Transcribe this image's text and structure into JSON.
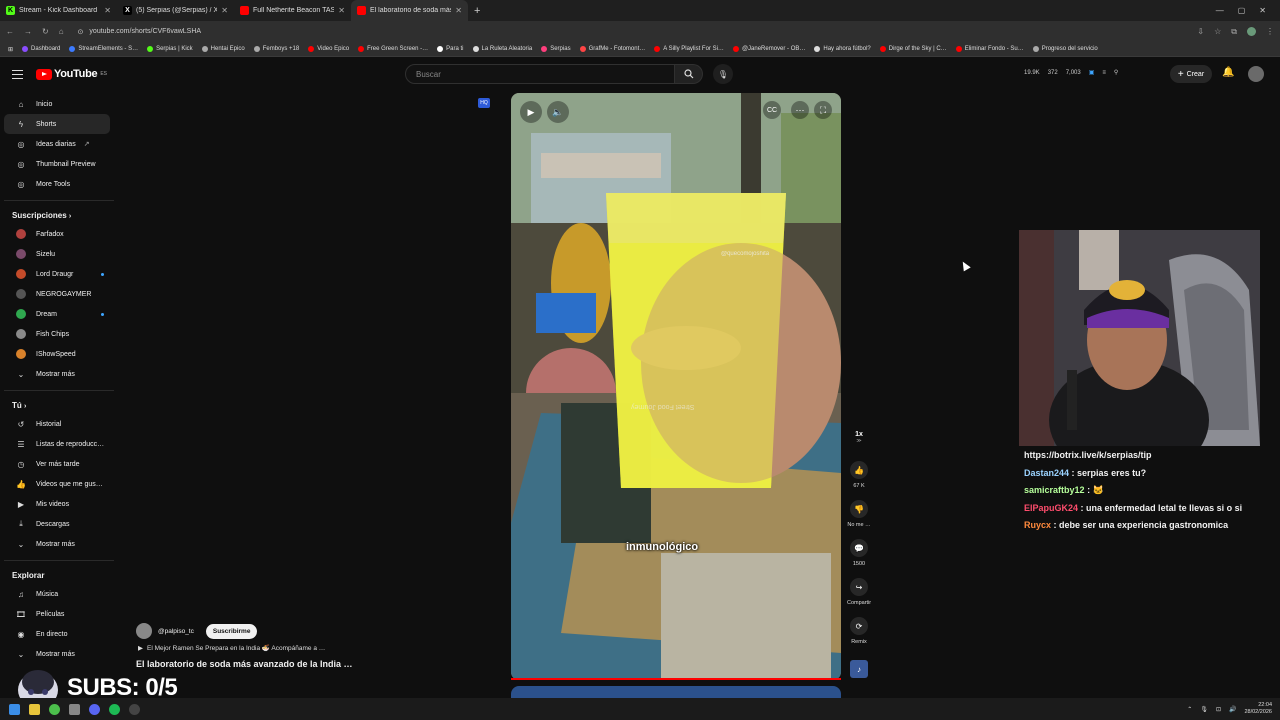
{
  "browser": {
    "tabs": [
      {
        "title": "Stream - Kick Dashboard",
        "icon": "kick-icon",
        "color": "#53fc18"
      },
      {
        "title": "(5) Serpias (@Serpias) / X",
        "icon": "x-icon",
        "color": "#ffffff"
      },
      {
        "title": "Full Netherite Beacon TAS (4 m…",
        "icon": "youtube-icon",
        "color": "#ff0000"
      },
      {
        "title": "El laboratorio de soda más avan…",
        "icon": "youtube-icon",
        "color": "#ff0000",
        "active": true
      }
    ],
    "new_tab": "+",
    "url": "youtube.com/shorts/CVF6vawLSHA",
    "bookmarks": [
      {
        "label": "Dashboard",
        "color": "#8a4dff"
      },
      {
        "label": "StreamElements - S…",
        "color": "#3c7bff"
      },
      {
        "label": "Serpias | Kick",
        "color": "#53fc18"
      },
      {
        "label": "Hentai Epico",
        "color": "#aaaaaa"
      },
      {
        "label": "Femboys +18",
        "color": "#aaaaaa"
      },
      {
        "label": "Video Epico",
        "color": "#ff0000"
      },
      {
        "label": "Free Green Screen -…",
        "color": "#ff0000"
      },
      {
        "label": "Para ti",
        "color": "#ffffff"
      },
      {
        "label": "La Ruleta Aleatoria",
        "color": "#dddddd"
      },
      {
        "label": "Serpias",
        "color": "#ff3e7d"
      },
      {
        "label": "GrafMe - Fotomont…",
        "color": "#ff4444"
      },
      {
        "label": "A Silly Playlist For Si…",
        "color": "#ff0000"
      },
      {
        "label": "@JaneRemover - OB…",
        "color": "#ff0000"
      },
      {
        "label": "Hay ahora fútbol?",
        "color": "#dddddd"
      },
      {
        "label": "Dirge of the Sky | C…",
        "color": "#ff0000"
      },
      {
        "label": "Eliminar Fondo - Su…",
        "color": "#ff0000"
      },
      {
        "label": "Progreso del servicio",
        "color": "#aaaaaa"
      }
    ]
  },
  "youtube": {
    "logo": "YouTube",
    "logo_region": "ES",
    "search_placeholder": "Buscar",
    "stats": [
      "19.9K",
      "372",
      "7,003"
    ],
    "create_label": "Crear",
    "sidebar": {
      "main": [
        {
          "label": "Inicio",
          "icon": "home-icon"
        },
        {
          "label": "Shorts",
          "icon": "shorts-icon",
          "selected": true
        },
        {
          "label": "Ideas diarias",
          "icon": "bulb-icon"
        },
        {
          "label": "Thumbnail Preview",
          "icon": "image-icon"
        },
        {
          "label": "More Tools",
          "icon": "tools-icon"
        }
      ],
      "subs_header": "Suscripciones",
      "subs": [
        {
          "label": "Farfadox",
          "color": "#b0413e"
        },
        {
          "label": "Sizelu",
          "color": "#7a4a6a"
        },
        {
          "label": "Lord Draugr",
          "color": "#c44b2a",
          "live": true
        },
        {
          "label": "NEGROGAYMER",
          "color": "#555555"
        },
        {
          "label": "Dream",
          "color": "#2fa84f",
          "live": true
        },
        {
          "label": "Fish Chips",
          "color": "#8a8a8a"
        },
        {
          "label": "IShowSpeed",
          "color": "#d9822b"
        }
      ],
      "subs_more": "Mostrar más",
      "you_header": "Tú",
      "you": [
        {
          "label": "Historial",
          "icon": "history-icon"
        },
        {
          "label": "Listas de reproducc…",
          "icon": "playlist-icon"
        },
        {
          "label": "Ver más tarde",
          "icon": "clock-icon"
        },
        {
          "label": "Videos que me gus…",
          "icon": "like-icon"
        },
        {
          "label": "Mis videos",
          "icon": "video-icon"
        },
        {
          "label": "Descargas",
          "icon": "download-icon"
        }
      ],
      "you_more": "Mostrar más",
      "explore_header": "Explorar",
      "explore": [
        {
          "label": "Música",
          "icon": "music-icon"
        },
        {
          "label": "Películas",
          "icon": "film-icon"
        },
        {
          "label": "En directo",
          "icon": "live-icon"
        }
      ],
      "explore_more": "Mostrar más"
    },
    "short": {
      "subtitle": "inmunológico",
      "watermark": "@quecomojoshita",
      "watermark2": "Street Food Journey",
      "speed": "1x",
      "likes": "67 K",
      "dislike_label": "No me …",
      "comments": "1500",
      "share_label": "Compartir",
      "remix_label": "Remix",
      "channel": "@palpiso_tc",
      "subscribe_label": "Suscribirme",
      "related": "El Mejor Ramen Se Prepara en la India 🍜 Acompáñame a …",
      "title": "El laboratorio de soda más avanzado de la India …"
    }
  },
  "overlay": {
    "subs_counter": "SUBS: 0/5"
  },
  "chat": {
    "messages": [
      {
        "user": "",
        "text": "https://botrix.live/k/serpias/tip",
        "color": "#ffffff"
      },
      {
        "user": "Dastan244",
        "text": ": serpias eres tu?",
        "color": "#9bd3ff"
      },
      {
        "user": "samicraftby12",
        "text": ": 🐱",
        "color": "#b6ff9b"
      },
      {
        "user": "ElPapuGK24",
        "text": ": una enfermedad letal te llevas si o si",
        "color": "#ff4d6d"
      },
      {
        "user": "Ruycx",
        "text": ": debe ser una experiencia gastronomica",
        "color": "#ff8a3d"
      }
    ]
  },
  "taskbar": {
    "time": "22:04",
    "date": "28/02/2026"
  }
}
